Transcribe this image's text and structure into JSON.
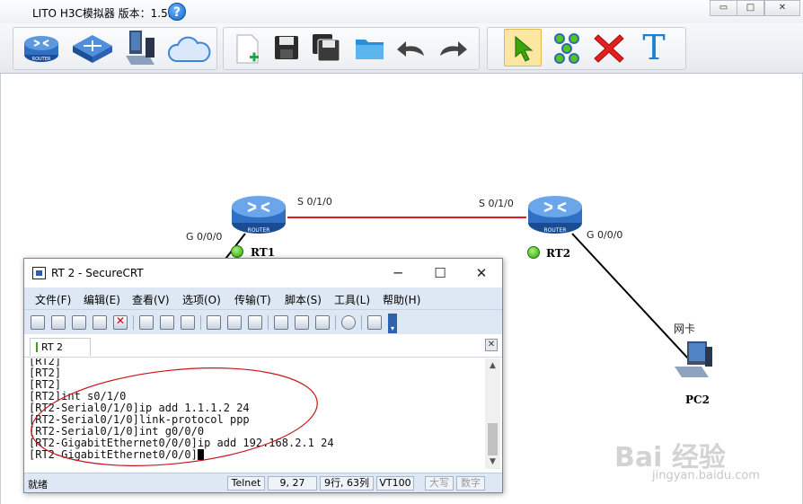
{
  "app": {
    "title": "LITO H3C模拟器 版本：1.5.2"
  },
  "window_controls": {
    "minimize": "▭",
    "maximize": "□",
    "close": "✕"
  },
  "toolbar": {
    "tools": [
      "router-icon",
      "switch-icon",
      "pc-icon",
      "cloud-icon",
      "new-file-icon",
      "save-icon",
      "save-as-icon",
      "open-folder-icon",
      "undo-icon",
      "redo-icon",
      "select-pointer-icon",
      "connect-icon",
      "delete-icon",
      "text-icon"
    ],
    "text_tool_glyph": "T"
  },
  "topology": {
    "rt1": {
      "name": "RT1",
      "iface_left": "G 0/0/0",
      "iface_right": "S 0/1/0"
    },
    "rt2": {
      "name": "RT2",
      "iface_left": "S 0/1/0",
      "iface_right": "G 0/0/0"
    },
    "router_badge": "ROUTER",
    "pc2": {
      "name": "PC2",
      "iface": "网卡"
    },
    "link_color": "#e21b1b"
  },
  "securecrt": {
    "title": "RT 2 - SecureCRT",
    "menu": [
      "文件(F)",
      "编辑(E)",
      "查看(V)",
      "选项(O)",
      "传输(T)",
      "脚本(S)",
      "工具(L)",
      "帮助(H)"
    ],
    "tab_label": "RT 2",
    "terminal_lines": [
      "[RT2]",
      "[RT2]",
      "[RT2]",
      "[RT2]int s0/1/0",
      "[RT2-Serial0/1/0]ip add 1.1.1.2 24",
      "[RT2-Serial0/1/0]link-protocol ppp",
      "[RT2-Serial0/1/0]int g0/0/0",
      "[RT2-GigabitEthernet0/0/0]ip add 192.168.2.1 24",
      "[RT2-GigabitEthernet0/0/0]"
    ],
    "status": {
      "ready": "就绪",
      "protocol": "Telnet",
      "position": "9,  27",
      "rows_cols": "9行, 63列",
      "terminal": "VT100",
      "caps": "大写",
      "num": "数字"
    }
  },
  "watermark": {
    "brand": "Bai 经验",
    "url": "jingyan.baidu.com"
  }
}
